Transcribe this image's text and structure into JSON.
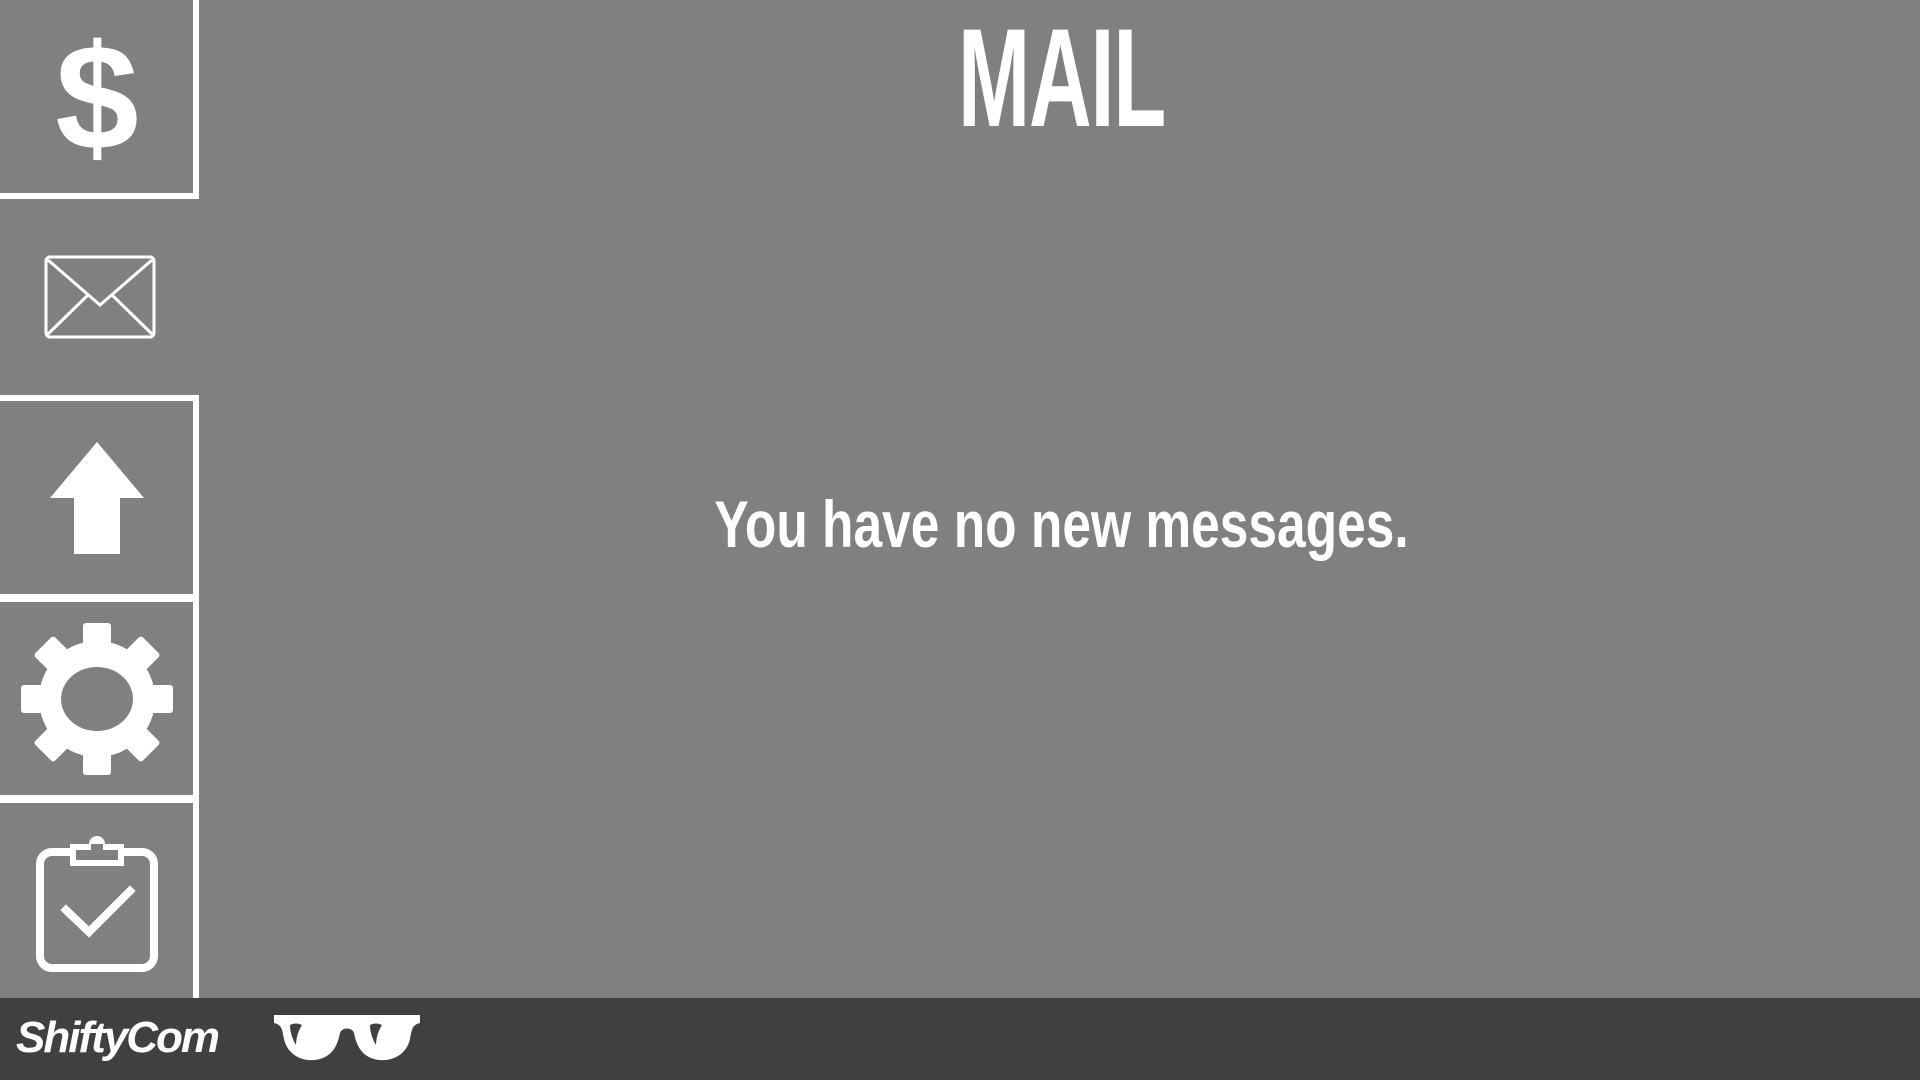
{
  "header": {
    "title": "MAIL"
  },
  "main": {
    "empty_message": "You have no new messages."
  },
  "sidebar": {
    "items": [
      {
        "id": "money",
        "icon": "dollar-icon",
        "active": false
      },
      {
        "id": "mail",
        "icon": "envelope-icon",
        "active": true
      },
      {
        "id": "upgrade",
        "icon": "arrow-up-icon",
        "active": false
      },
      {
        "id": "settings",
        "icon": "gear-icon",
        "active": false
      },
      {
        "id": "tasks",
        "icon": "clipboard-check-icon",
        "active": false
      }
    ]
  },
  "footer": {
    "brand": "ShiftyCom",
    "logo_icon": "sunglasses-icon"
  },
  "colors": {
    "background": "#808080",
    "bottom_bar": "#404040",
    "foreground": "#ffffff"
  }
}
